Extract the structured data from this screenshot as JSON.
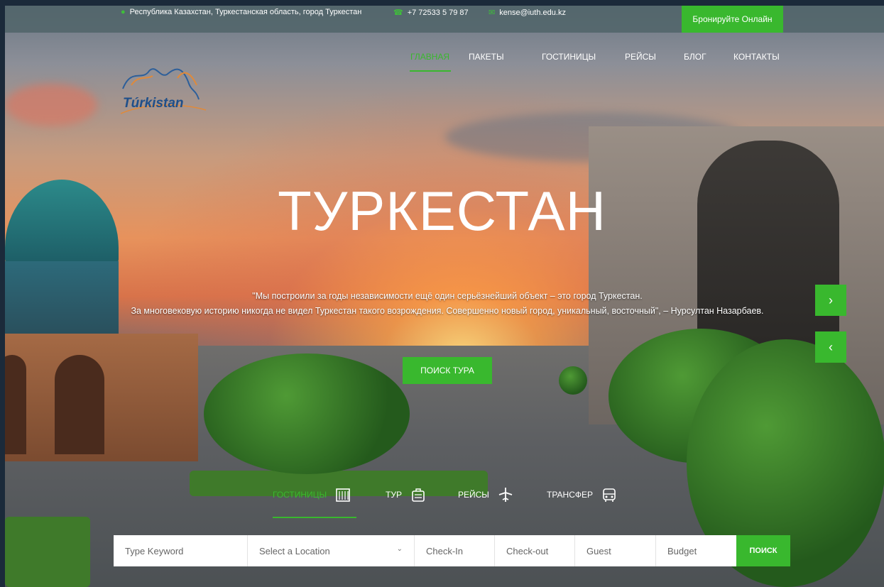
{
  "topbar": {
    "address": "Республика Казахстан, Туркестанская область, город Туркестан",
    "phone": "+7 72533 5 79 87",
    "email": "kense@iuth.edu.kz",
    "book_button": "Бронируйте Онлайн",
    "icons": [
      "location-pin-icon",
      "phone-icon",
      "mail-icon"
    ]
  },
  "logo": {
    "text": "Túrkistan"
  },
  "nav": {
    "items": [
      {
        "label": "ГЛАВНАЯ",
        "active": true
      },
      {
        "label": "ПАКЕТЫ",
        "active": false
      },
      {
        "label": "ГОСТИНИЦЫ",
        "active": false
      },
      {
        "label": "РЕЙСЫ",
        "active": false
      },
      {
        "label": "БЛОГ",
        "active": false
      },
      {
        "label": "КОНТАКТЫ",
        "active": false
      }
    ]
  },
  "hero": {
    "title": "ТУРКЕСТАН",
    "quote_line1": "\"Мы построили за годы независимости ещё один серьёзнейший объект – это город Туркестан.",
    "quote_line2": "За многовековую историю никогда не видел Туркестан такого возрождения. Совершенно новый город, уникальный, восточный\", – Нурсултан Назарбаев.",
    "search_tour_button": "ПОИСК ТУРА",
    "next_arrow": "›",
    "prev_arrow": "‹"
  },
  "tabs": [
    {
      "label": "ГОСТИНИЦЫ",
      "icon": "hotel-building-icon",
      "active": true
    },
    {
      "label": "ТУР",
      "icon": "suitcase-icon",
      "active": false
    },
    {
      "label": "РЕЙСЫ",
      "icon": "airplane-icon",
      "active": false
    },
    {
      "label": "ТРАНСФЕР",
      "icon": "car-icon",
      "active": false
    }
  ],
  "search": {
    "keyword_placeholder": "Type Keyword",
    "location_placeholder": "Select a Location",
    "checkin_placeholder": "Check-In",
    "checkout_placeholder": "Check-out",
    "guest_placeholder": "Guest",
    "budget_placeholder": "Budget",
    "submit_label": "ПОИСК"
  },
  "colors": {
    "accent": "#39b82e",
    "topbar": "#50646a"
  }
}
